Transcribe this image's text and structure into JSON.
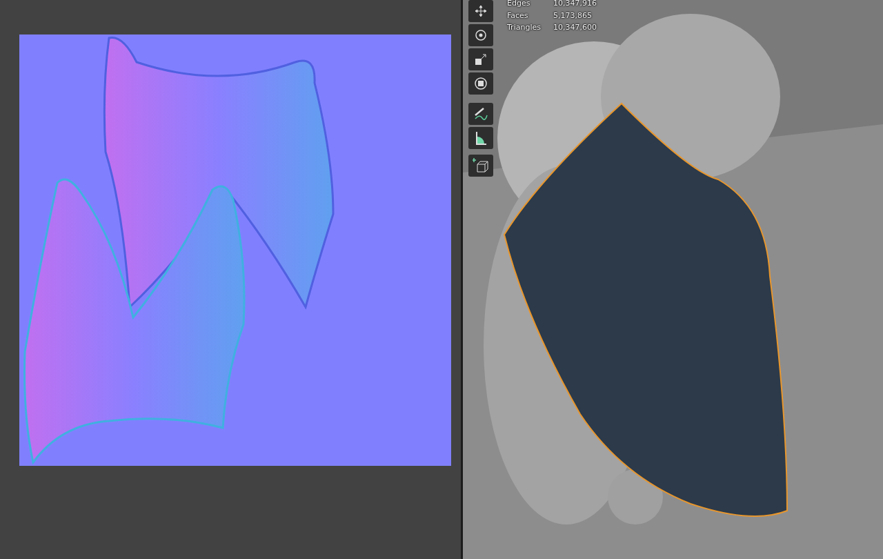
{
  "viewport": {
    "statistics": [
      {
        "label": "Edges",
        "value": "10,347,916"
      },
      {
        "label": "Faces",
        "value": "5,173,865"
      },
      {
        "label": "Triangles",
        "value": "10,347,600"
      }
    ]
  }
}
